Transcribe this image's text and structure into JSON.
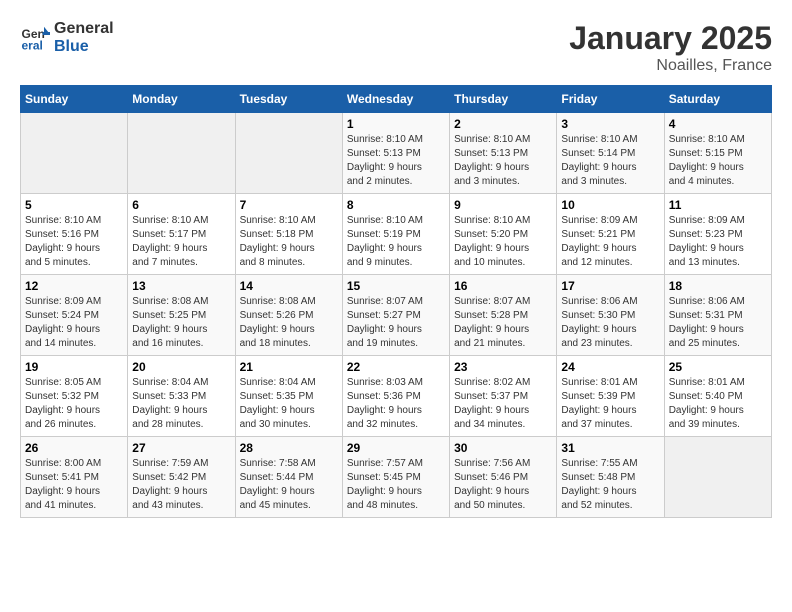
{
  "logo": {
    "line1": "General",
    "line2": "Blue"
  },
  "title": "January 2025",
  "subtitle": "Noailles, France",
  "weekdays": [
    "Sunday",
    "Monday",
    "Tuesday",
    "Wednesday",
    "Thursday",
    "Friday",
    "Saturday"
  ],
  "weeks": [
    [
      {
        "day": "",
        "info": ""
      },
      {
        "day": "",
        "info": ""
      },
      {
        "day": "",
        "info": ""
      },
      {
        "day": "1",
        "info": "Sunrise: 8:10 AM\nSunset: 5:13 PM\nDaylight: 9 hours\nand 2 minutes."
      },
      {
        "day": "2",
        "info": "Sunrise: 8:10 AM\nSunset: 5:13 PM\nDaylight: 9 hours\nand 3 minutes."
      },
      {
        "day": "3",
        "info": "Sunrise: 8:10 AM\nSunset: 5:14 PM\nDaylight: 9 hours\nand 3 minutes."
      },
      {
        "day": "4",
        "info": "Sunrise: 8:10 AM\nSunset: 5:15 PM\nDaylight: 9 hours\nand 4 minutes."
      }
    ],
    [
      {
        "day": "5",
        "info": "Sunrise: 8:10 AM\nSunset: 5:16 PM\nDaylight: 9 hours\nand 5 minutes."
      },
      {
        "day": "6",
        "info": "Sunrise: 8:10 AM\nSunset: 5:17 PM\nDaylight: 9 hours\nand 7 minutes."
      },
      {
        "day": "7",
        "info": "Sunrise: 8:10 AM\nSunset: 5:18 PM\nDaylight: 9 hours\nand 8 minutes."
      },
      {
        "day": "8",
        "info": "Sunrise: 8:10 AM\nSunset: 5:19 PM\nDaylight: 9 hours\nand 9 minutes."
      },
      {
        "day": "9",
        "info": "Sunrise: 8:10 AM\nSunset: 5:20 PM\nDaylight: 9 hours\nand 10 minutes."
      },
      {
        "day": "10",
        "info": "Sunrise: 8:09 AM\nSunset: 5:21 PM\nDaylight: 9 hours\nand 12 minutes."
      },
      {
        "day": "11",
        "info": "Sunrise: 8:09 AM\nSunset: 5:23 PM\nDaylight: 9 hours\nand 13 minutes."
      }
    ],
    [
      {
        "day": "12",
        "info": "Sunrise: 8:09 AM\nSunset: 5:24 PM\nDaylight: 9 hours\nand 14 minutes."
      },
      {
        "day": "13",
        "info": "Sunrise: 8:08 AM\nSunset: 5:25 PM\nDaylight: 9 hours\nand 16 minutes."
      },
      {
        "day": "14",
        "info": "Sunrise: 8:08 AM\nSunset: 5:26 PM\nDaylight: 9 hours\nand 18 minutes."
      },
      {
        "day": "15",
        "info": "Sunrise: 8:07 AM\nSunset: 5:27 PM\nDaylight: 9 hours\nand 19 minutes."
      },
      {
        "day": "16",
        "info": "Sunrise: 8:07 AM\nSunset: 5:28 PM\nDaylight: 9 hours\nand 21 minutes."
      },
      {
        "day": "17",
        "info": "Sunrise: 8:06 AM\nSunset: 5:30 PM\nDaylight: 9 hours\nand 23 minutes."
      },
      {
        "day": "18",
        "info": "Sunrise: 8:06 AM\nSunset: 5:31 PM\nDaylight: 9 hours\nand 25 minutes."
      }
    ],
    [
      {
        "day": "19",
        "info": "Sunrise: 8:05 AM\nSunset: 5:32 PM\nDaylight: 9 hours\nand 26 minutes."
      },
      {
        "day": "20",
        "info": "Sunrise: 8:04 AM\nSunset: 5:33 PM\nDaylight: 9 hours\nand 28 minutes."
      },
      {
        "day": "21",
        "info": "Sunrise: 8:04 AM\nSunset: 5:35 PM\nDaylight: 9 hours\nand 30 minutes."
      },
      {
        "day": "22",
        "info": "Sunrise: 8:03 AM\nSunset: 5:36 PM\nDaylight: 9 hours\nand 32 minutes."
      },
      {
        "day": "23",
        "info": "Sunrise: 8:02 AM\nSunset: 5:37 PM\nDaylight: 9 hours\nand 34 minutes."
      },
      {
        "day": "24",
        "info": "Sunrise: 8:01 AM\nSunset: 5:39 PM\nDaylight: 9 hours\nand 37 minutes."
      },
      {
        "day": "25",
        "info": "Sunrise: 8:01 AM\nSunset: 5:40 PM\nDaylight: 9 hours\nand 39 minutes."
      }
    ],
    [
      {
        "day": "26",
        "info": "Sunrise: 8:00 AM\nSunset: 5:41 PM\nDaylight: 9 hours\nand 41 minutes."
      },
      {
        "day": "27",
        "info": "Sunrise: 7:59 AM\nSunset: 5:42 PM\nDaylight: 9 hours\nand 43 minutes."
      },
      {
        "day": "28",
        "info": "Sunrise: 7:58 AM\nSunset: 5:44 PM\nDaylight: 9 hours\nand 45 minutes."
      },
      {
        "day": "29",
        "info": "Sunrise: 7:57 AM\nSunset: 5:45 PM\nDaylight: 9 hours\nand 48 minutes."
      },
      {
        "day": "30",
        "info": "Sunrise: 7:56 AM\nSunset: 5:46 PM\nDaylight: 9 hours\nand 50 minutes."
      },
      {
        "day": "31",
        "info": "Sunrise: 7:55 AM\nSunset: 5:48 PM\nDaylight: 9 hours\nand 52 minutes."
      },
      {
        "day": "",
        "info": ""
      }
    ]
  ]
}
